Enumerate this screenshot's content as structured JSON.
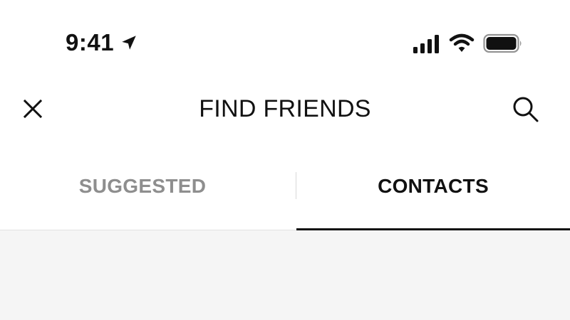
{
  "status_bar": {
    "time": "9:41",
    "icons": [
      "location-arrow-icon",
      "cellular-signal-icon",
      "wifi-icon",
      "battery-icon"
    ]
  },
  "header": {
    "title": "FIND FRIENDS",
    "left_icon": "close-icon",
    "right_icon": "search-icon"
  },
  "tabs": [
    {
      "label": "SUGGESTED",
      "active": false
    },
    {
      "label": "CONTACTS",
      "active": true
    }
  ],
  "colors": {
    "text": "#111111",
    "inactive_tab": "#8e8e8e",
    "content_background": "#f5f5f5",
    "divider": "#e2e2e2"
  }
}
